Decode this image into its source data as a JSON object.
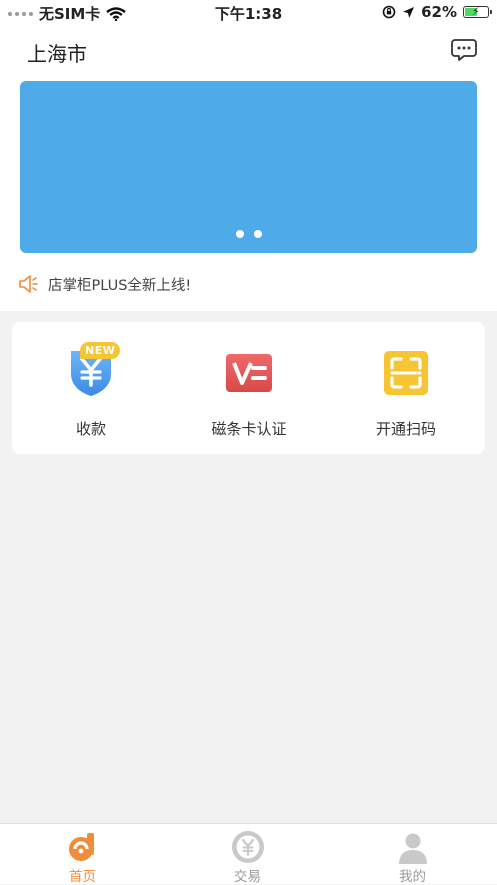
{
  "status_bar": {
    "carrier": "无SIM卡",
    "time": "下午1:38",
    "battery": "62%",
    "battery_level": 0.62
  },
  "header": {
    "city": "上海市"
  },
  "banner": {
    "page_count": 2
  },
  "notice": {
    "text": "店掌柜PLUS全新上线!"
  },
  "quick_actions": [
    {
      "label": "收款",
      "badge": "NEW",
      "icon": "yuan-shield-icon"
    },
    {
      "label": "磁条卡认证",
      "icon": "card-verify-icon"
    },
    {
      "label": "开通扫码",
      "icon": "scan-icon"
    }
  ],
  "tabbar": {
    "items": [
      {
        "label": "首页",
        "icon": "home-logo-icon",
        "active": true
      },
      {
        "label": "交易",
        "icon": "yuan-coin-icon",
        "active": false
      },
      {
        "label": "我的",
        "icon": "person-icon",
        "active": false
      }
    ]
  },
  "colors": {
    "accent": "#f08c3a",
    "banner": "#4eabe8",
    "inactive_tab": "#999999",
    "badge": "#f7c533"
  }
}
